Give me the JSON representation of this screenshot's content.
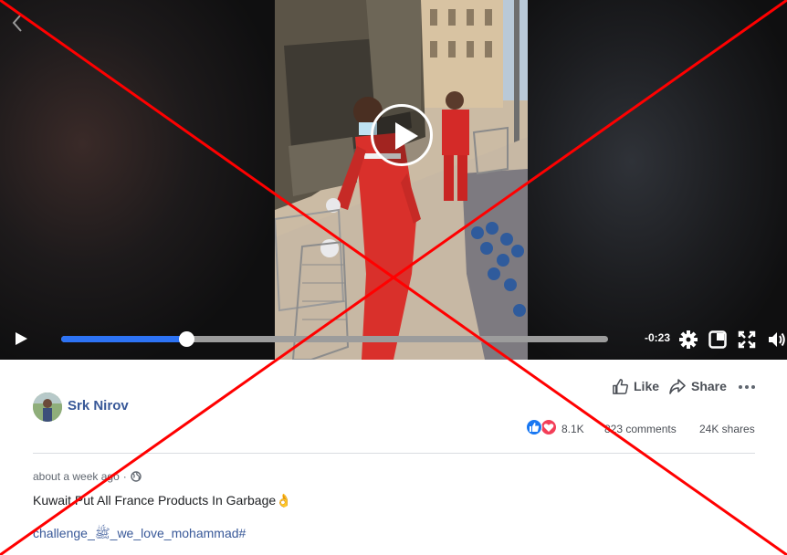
{
  "video": {
    "time_remaining": "-0:23",
    "progress": 0.229,
    "icons": [
      "back-chevron-icon",
      "play-icon",
      "settings-gear-icon",
      "picture-in-picture-icon",
      "fullscreen-icon",
      "volume-icon"
    ]
  },
  "post": {
    "author": "Srk Nirov",
    "actions": {
      "like": "Like",
      "share": "Share"
    },
    "reactions": {
      "count": "8.1K",
      "types": [
        "like",
        "love"
      ]
    },
    "comments": "823 comments",
    "shares": "24K shares",
    "timestamp": "about a week ago",
    "timestamp_separator": "·",
    "caption": "Kuwait Put All France Products In Garbage👌",
    "hashtag": "challenge_ﷺ_we_love_mohammad#"
  },
  "colors": {
    "link_blue": "#385898",
    "scrub_fill": "#2d73f5",
    "overlay_x": "#ff0000",
    "like_blue": "#1877f2",
    "love_red": "#f33e58"
  }
}
